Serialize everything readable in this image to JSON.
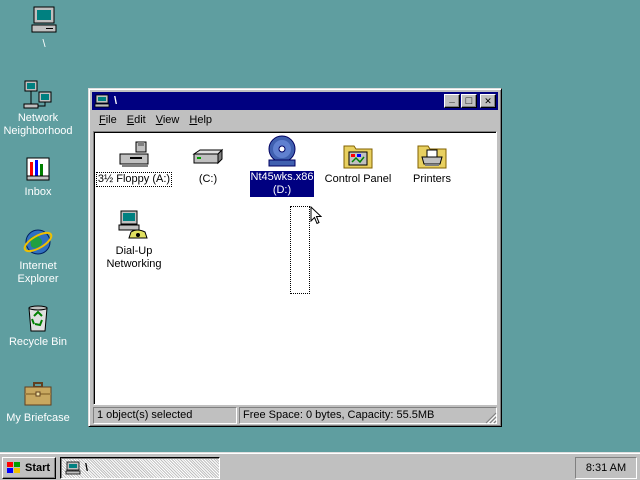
{
  "desktop": {
    "background": "#5f9ea0",
    "icons": [
      {
        "label": "\\",
        "icon": "computer-icon"
      },
      {
        "label": "Network Neighborhood",
        "icon": "network-icon"
      },
      {
        "label": "Inbox",
        "icon": "inbox-icon"
      },
      {
        "label": "Internet Explorer",
        "icon": "internet-explorer-icon"
      },
      {
        "label": "Recycle Bin",
        "icon": "recycle-bin-icon"
      },
      {
        "label": "My Briefcase",
        "icon": "briefcase-icon"
      }
    ]
  },
  "window": {
    "title": "\\",
    "title_color": "#000080",
    "buttons": {
      "minimize": "_",
      "maximize": "□",
      "close": "✕"
    },
    "menu": [
      {
        "label": "File",
        "accel": "F",
        "rest": "ile"
      },
      {
        "label": "Edit",
        "accel": "E",
        "rest": "dit"
      },
      {
        "label": "View",
        "accel": "V",
        "rest": "iew"
      },
      {
        "label": "Help",
        "accel": "H",
        "rest": "elp"
      }
    ],
    "items": [
      {
        "label": "3½ Floppy (A:)",
        "icon": "floppy-drive-icon",
        "focused": true
      },
      {
        "label": "(C:)",
        "icon": "hard-drive-icon"
      },
      {
        "label": "Nt45wks.x86 (D:)",
        "line1": "Nt45wks.x86",
        "line2": "(D:)",
        "icon": "cd-rom-icon",
        "selected": true
      },
      {
        "label": "Control Panel",
        "icon": "control-panel-icon"
      },
      {
        "label": "Printers",
        "icon": "printers-icon"
      },
      {
        "label": "Dial-Up Networking",
        "line1": "Dial-Up",
        "line2": "Networking",
        "icon": "dial-up-networking-icon"
      }
    ],
    "status": {
      "selection": "1 object(s) selected",
      "space": "Free Space: 0 bytes,  Capacity: 55.5MB"
    }
  },
  "taskbar": {
    "start_label": "Start",
    "task_label": "\\",
    "clock": "8:31 AM"
  }
}
